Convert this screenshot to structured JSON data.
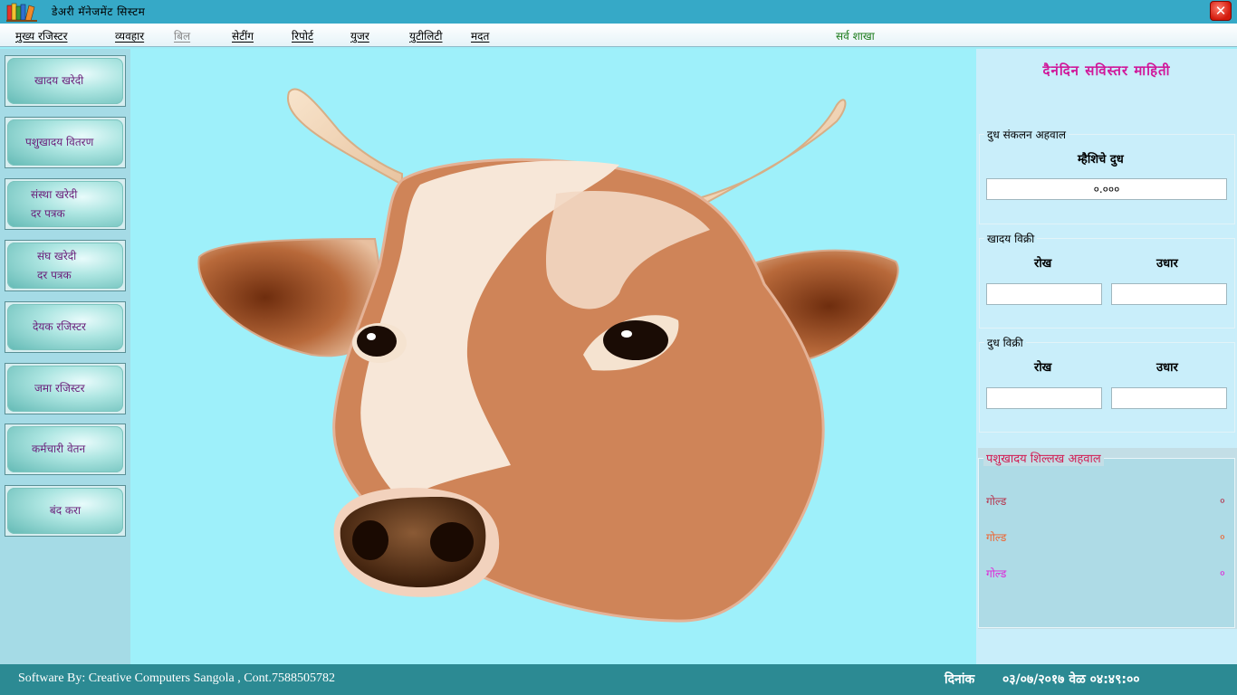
{
  "window": {
    "title": "डेअरी मॅनेजमेंट सिस्टम",
    "close_glyph": "✕",
    "app_icon": "books-icon"
  },
  "menu": {
    "items": [
      {
        "label": "मुख्य रजिस्टर",
        "enabled": true
      },
      {
        "label": "व्यवहार",
        "enabled": true
      },
      {
        "label": "बिल",
        "enabled": false
      },
      {
        "label": "सेटींग",
        "enabled": true
      },
      {
        "label": "रिपोर्ट",
        "enabled": true
      },
      {
        "label": "युजर",
        "enabled": true
      },
      {
        "label": "युटीलिटी",
        "enabled": true
      },
      {
        "label": "मदत",
        "enabled": true
      }
    ],
    "branch": "सर्व शाखा"
  },
  "sidebar": {
    "buttons": [
      {
        "line1": "खादय खरेदी",
        "line2": ""
      },
      {
        "line1": "पशुखादय वितरण",
        "line2": ""
      },
      {
        "line1": "संस्था खरेदी",
        "line2": "दर पत्रक"
      },
      {
        "line1": "संघ खरेदी",
        "line2": "दर पत्रक"
      },
      {
        "line1": "देयक रजिस्टर",
        "line2": ""
      },
      {
        "line1": "जमा रजिस्टर",
        "line2": ""
      },
      {
        "line1": "कर्मचारी वेतन",
        "line2": ""
      },
      {
        "line1": "बंद करा",
        "line2": ""
      }
    ]
  },
  "center": {
    "image": "cow-head-illustration"
  },
  "right": {
    "title": "दैनंदिन सविस्तर माहिती",
    "milk_collection": {
      "legend": "दुध संकलन अहवाल",
      "label": "म्हैशिचे दुध",
      "value": "०.०००"
    },
    "feed_sales": {
      "legend": "खादय विक्री",
      "cash_label": "रोख",
      "credit_label": "उधार",
      "cash_value": "",
      "credit_value": ""
    },
    "milk_sales": {
      "legend": "दुध विक्री",
      "cash_label": "रोख",
      "credit_label": "उधार",
      "cash_value": "",
      "credit_value": ""
    },
    "stock": {
      "legend": "पशुखादय शिल्लख अहवाल",
      "items": [
        {
          "name": "गोल्ड",
          "value": "०",
          "color": "#b5304a"
        },
        {
          "name": "गोल्ड",
          "value": "०",
          "color": "#f0602a"
        },
        {
          "name": "गोल्ड",
          "value": "०",
          "color": "#e020d8"
        }
      ]
    }
  },
  "status": {
    "credit": "Software By: Creative Computers Sangola , Cont.7588505782",
    "date_label": "दिनांक",
    "date_value": "०३/०७/२०१७ वेळ ०४:४९:००"
  }
}
